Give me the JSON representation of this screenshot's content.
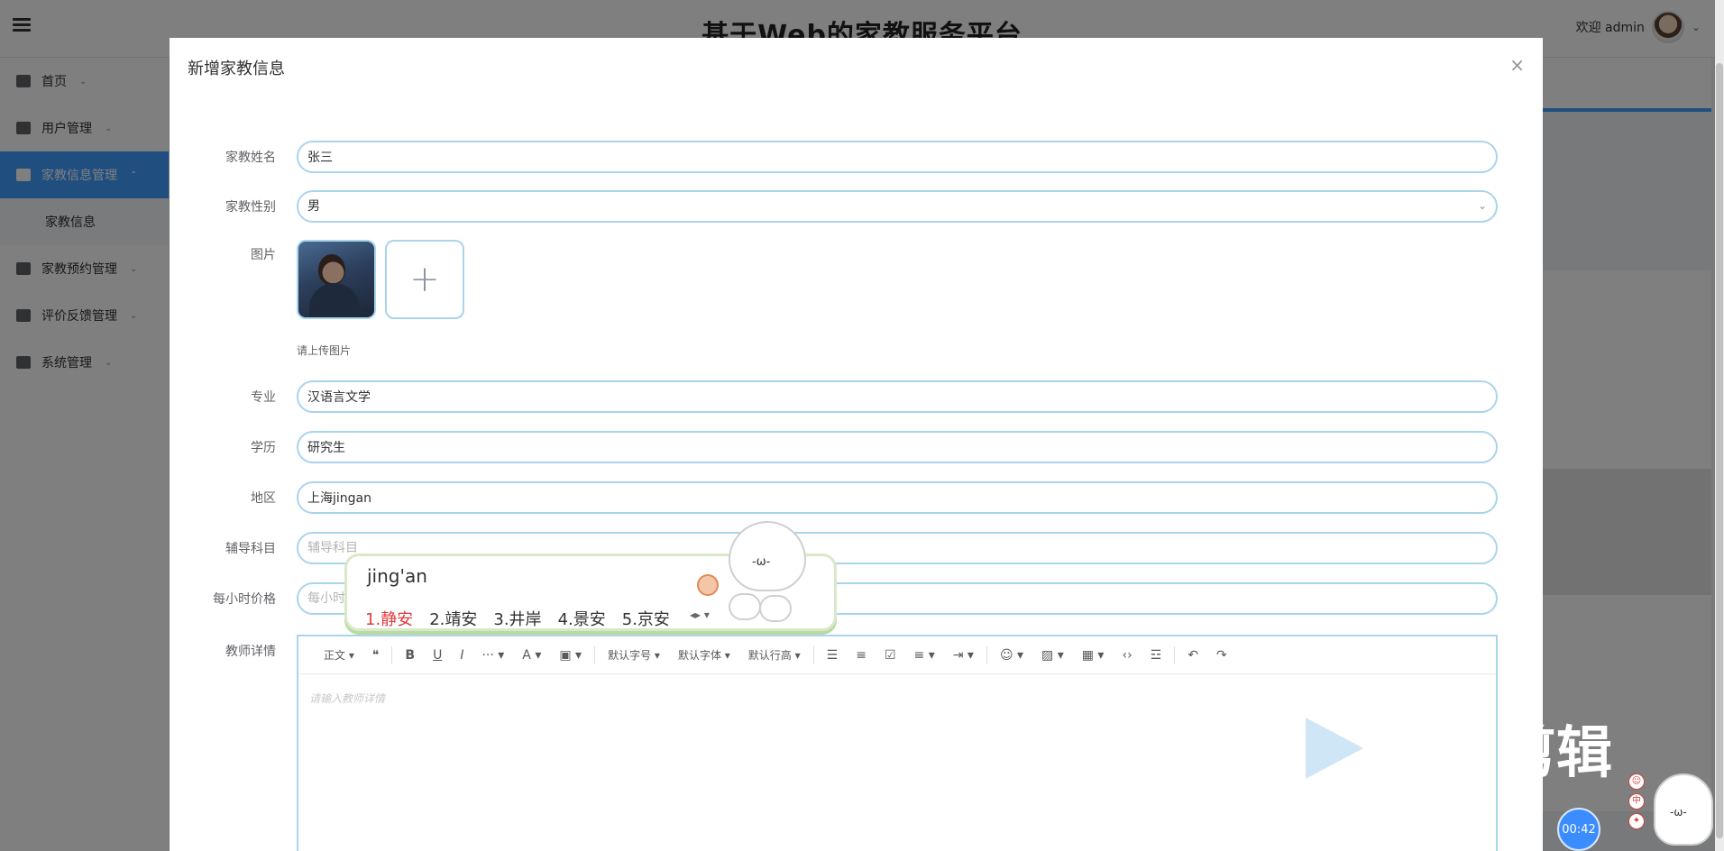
{
  "header": {
    "title": "基于Web的家教服务平台",
    "welcome": "欢迎 admin"
  },
  "sidebar": {
    "items": [
      {
        "label": "首页"
      },
      {
        "label": "用户管理"
      },
      {
        "label": "家教信息管理"
      },
      {
        "label": "家教信息"
      },
      {
        "label": "家教预约管理"
      },
      {
        "label": "评价反馈管理"
      },
      {
        "label": "系统管理"
      }
    ]
  },
  "modal": {
    "title": "新增家教信息",
    "close": "×",
    "fields": {
      "name": {
        "label": "家教姓名",
        "value": "张三"
      },
      "gender": {
        "label": "家教性别",
        "value": "男"
      },
      "image": {
        "label": "图片",
        "hint": "请上传图片",
        "add": "+"
      },
      "major": {
        "label": "专业",
        "value": "汉语言文学"
      },
      "education": {
        "label": "学历",
        "value": "研究生"
      },
      "region": {
        "label": "地区",
        "value": "上海jingan"
      },
      "subject": {
        "label": "辅导科目",
        "placeholder": "辅导科目"
      },
      "price": {
        "label": "每小时价格",
        "placeholder": "每小时价格"
      },
      "details": {
        "label": "教师详情",
        "placeholder": "请输入教师详情"
      }
    },
    "toolbar": {
      "paragraph": "正文",
      "font_size": "默认字号",
      "font_family": "默认字体",
      "line_height": "默认行高"
    }
  },
  "ime": {
    "input": "jing'an",
    "candidates": [
      "1.静安",
      "2.靖安",
      "3.井岸",
      "4.景安",
      "5.京安"
    ]
  },
  "overlay": {
    "watermark_text": "剪辑",
    "timer": "00:42"
  }
}
